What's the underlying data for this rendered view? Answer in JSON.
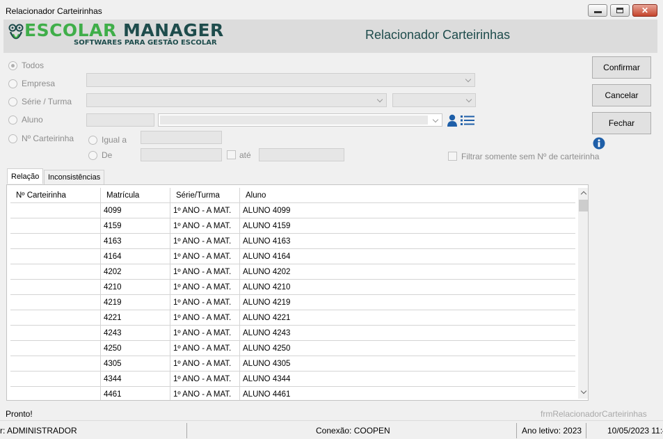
{
  "window": {
    "title": "Relacionador Carteirinhas",
    "close_glyph": "✕"
  },
  "header": {
    "logo_escolar": "ESCOLAR",
    "logo_manager": "MANAGER",
    "logo_sub": "SOFTWARES PARA GESTÃO ESCOLAR",
    "title": "Relacionador Carteirinhas"
  },
  "filters": {
    "todos": "Todos",
    "empresa": "Empresa",
    "serie_turma": "Série / Turma",
    "aluno": "Aluno",
    "n_carteirinha": "Nº Carteirinha",
    "igual_a": "Igual a",
    "de": "De",
    "ate": "até",
    "filtrar_sem": "Filtrar somente sem Nº de carteirinha",
    "selected": "Todos"
  },
  "buttons": {
    "confirmar": "Confirmar",
    "cancelar": "Cancelar",
    "fechar": "Fechar"
  },
  "tabs": [
    {
      "label": "Relação",
      "active": true
    },
    {
      "label": "Inconsistências",
      "active": false
    }
  ],
  "grid": {
    "columns": [
      "Nº Carteirinha",
      "Matrícula",
      "Série/Turma",
      "Aluno"
    ],
    "rows": [
      [
        "",
        "4099",
        "1º ANO - A MAT.",
        "ALUNO 4099"
      ],
      [
        "",
        "4159",
        "1º ANO - A MAT.",
        "ALUNO 4159"
      ],
      [
        "",
        "4163",
        "1º ANO - A MAT.",
        "ALUNO 4163"
      ],
      [
        "",
        "4164",
        "1º ANO - A MAT.",
        "ALUNO 4164"
      ],
      [
        "",
        "4202",
        "1º ANO - A MAT.",
        "ALUNO 4202"
      ],
      [
        "",
        "4210",
        "1º ANO - A MAT.",
        "ALUNO 4210"
      ],
      [
        "",
        "4219",
        "1º ANO - A MAT.",
        "ALUNO 4219"
      ],
      [
        "",
        "4221",
        "1º ANO - A MAT.",
        "ALUNO 4221"
      ],
      [
        "",
        "4243",
        "1º ANO - A MAT.",
        "ALUNO 4243"
      ],
      [
        "",
        "4250",
        "1º ANO - A MAT.",
        "ALUNO 4250"
      ],
      [
        "",
        "4305",
        "1º ANO - A MAT.",
        "ALUNO 4305"
      ],
      [
        "",
        "4344",
        "1º ANO - A MAT.",
        "ALUNO 4344"
      ],
      [
        "",
        "4461",
        "1º ANO - A MAT.",
        "ALUNO 4461"
      ]
    ]
  },
  "status": {
    "message": "Pronto!",
    "form_name": "frmRelacionadorCarteirinhas"
  },
  "statusbar": {
    "user": "r: ADMINISTRADOR",
    "conexao": "Conexão: COOPEN",
    "ano_letivo": "Ano letivo: 2023",
    "datetime": "10/05/2023 11:4"
  },
  "colors": {
    "brand_green": "#3fae49",
    "brand_dark": "#1e4c4c",
    "icon_blue": "#1f5fa8"
  }
}
